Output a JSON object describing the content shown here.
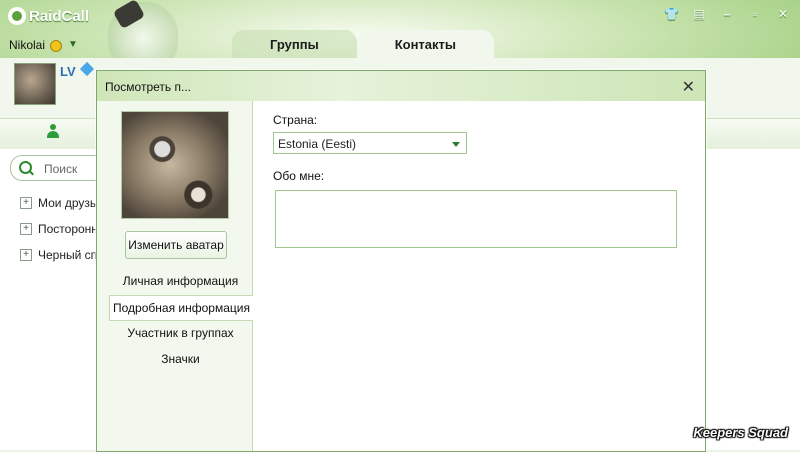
{
  "app": {
    "brand": "RaidCall",
    "username": "Nikolai",
    "tabs": [
      {
        "label": "Группы",
        "active": false
      },
      {
        "label": "Контакты",
        "active": true
      }
    ],
    "profile_level": "LV",
    "search_placeholder": "Поиск",
    "groups": [
      "Мои друзья",
      "Посторонни",
      "Черный спи"
    ],
    "window_controls": [
      "shirt-icon",
      "note-icon",
      "minimize-icon",
      "maximize-icon",
      "close-icon"
    ]
  },
  "dialog": {
    "title": "Посмотреть п...",
    "change_avatar_label": "Изменить аватар",
    "menu": [
      {
        "label": "Личная информация",
        "selected": false
      },
      {
        "label": "Подробная информация",
        "selected": true
      },
      {
        "label": "Участник в группах",
        "selected": false
      },
      {
        "label": "Значки",
        "selected": false
      }
    ],
    "country_label": "Страна:",
    "country_value": "Estonia (Eesti)",
    "about_label": "Обо мне:",
    "about_value": ""
  },
  "watermark": "Keepers Squad",
  "colors": {
    "accent_green": "#5aa33c",
    "tab_bar": "#f1f7ec",
    "border_green": "#9fc78f"
  }
}
